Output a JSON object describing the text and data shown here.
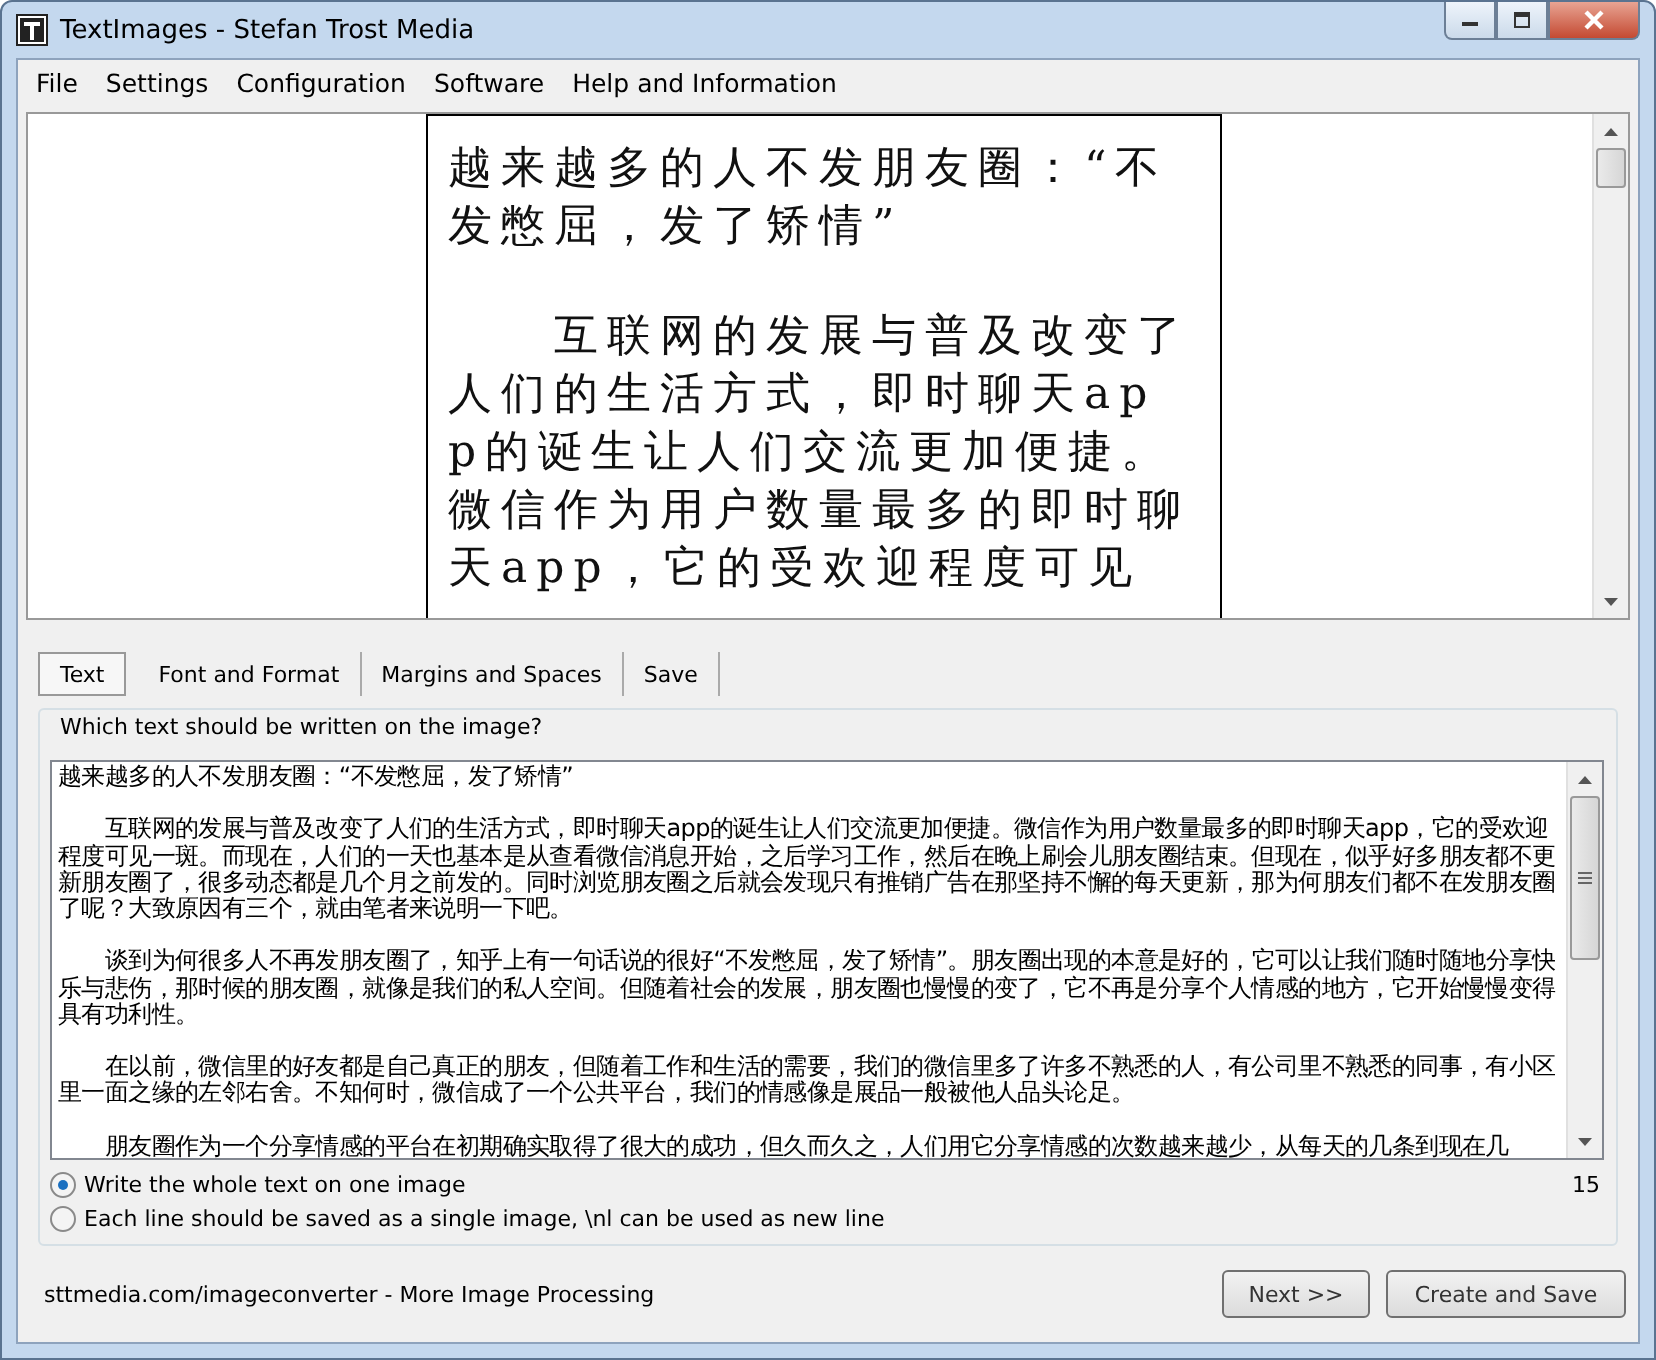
{
  "window": {
    "title": "TextImages - Stefan Trost Media"
  },
  "menu": [
    "File",
    "Settings",
    "Configuration",
    "Software",
    "Help and Information"
  ],
  "preview": {
    "paragraphs": [
      [
        "越来越多的人不发朋友圈：“不",
        "发憋屈，发了矫情”"
      ],
      [
        "　　互联网的发展与普及改变了",
        "人们的生活方式，即时聊天ap",
        "p的诞生让人们交流更加便捷。",
        "微信作为用户数量最多的即时聊",
        "天app，它的受欢迎程度可见"
      ]
    ]
  },
  "tabs": [
    {
      "label": "Text",
      "selected": true
    },
    {
      "label": "Font and Format",
      "selected": false
    },
    {
      "label": "Margins and Spaces",
      "selected": false
    },
    {
      "label": "Save",
      "selected": false
    }
  ],
  "group": {
    "title": "Which text should be written on the image?"
  },
  "text_field": {
    "paragraphs": [
      "越来越多的人不发朋友圈：“不发憋屈，发了矫情”",
      "　　互联网的发展与普及改变了人们的生活方式，即时聊天app的诞生让人们交流更加便捷。微信作为用户数量最多的即时聊天app，它的受欢迎程度可见一斑。而现在，人们的一天也基本是从查看微信消息开始，之后学习工作，然后在晚上刷会儿朋友圈结束。但现在，似乎好多朋友都不更新朋友圈了，很多动态都是几个月之前发的。同时浏览朋友圈之后就会发现只有推销广告在那坚持不懈的每天更新，那为何朋友们都不在发朋友圈了呢？大致原因有三个，就由笔者来说明一下吧。",
      "　　谈到为何很多人不再发朋友圈了，知乎上有一句话说的很好“不发憋屈，发了矫情”。朋友圈出现的本意是好的，它可以让我们随时随地分享快乐与悲伤，那时候的朋友圈，就像是我们的私人空间。但随着社会的发展，朋友圈也慢慢的变了，它不再是分享个人情感的地方，它开始慢慢变得具有功利性。",
      "　　在以前，微信里的好友都是自己真正的朋友，但随着工作和生活的需要，我们的微信里多了许多不熟悉的人，有公司里不熟悉的同事，有小区里一面之缘的左邻右舍。不知何时，微信成了一个公共平台，我们的情感像是展品一般被他人品头论足。",
      "　　朋友圈作为一个分享情感的平台在初期确实取得了很大的成功，但久而久之，人们用它分享情感的次数越来越少，从每天的几条到现在几"
    ]
  },
  "options": [
    {
      "label": "Write the whole text on one image",
      "selected": true
    },
    {
      "label": "Each line should be saved as a single image, \\nl can be used as new line",
      "selected": false
    }
  ],
  "counter": "15",
  "status_link": "sttmedia.com/imageconverter - More Image Processing",
  "buttons": [
    "Next >>",
    "Create and Save"
  ]
}
